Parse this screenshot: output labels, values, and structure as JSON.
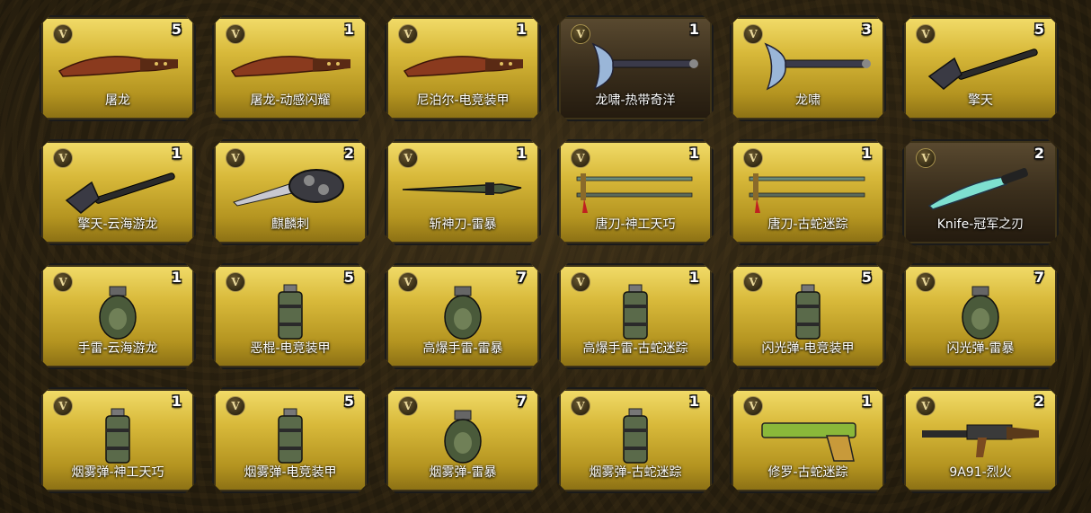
{
  "badge_letter": "V",
  "items": [
    {
      "name": "屠龙",
      "count": "5",
      "icon": "kukri-knife-icon",
      "dark": false
    },
    {
      "name": "屠龙-动感闪耀",
      "count": "1",
      "icon": "kukri-knife-icon",
      "dark": false
    },
    {
      "name": "尼泊尔-电竞装甲",
      "count": "1",
      "icon": "kukri-knife-icon",
      "dark": false
    },
    {
      "name": "龙啸-热带奇洋",
      "count": "1",
      "icon": "axe-icon",
      "dark": true
    },
    {
      "name": "龙啸",
      "count": "3",
      "icon": "axe-icon",
      "dark": false
    },
    {
      "name": "擎天",
      "count": "5",
      "icon": "shovel-icon",
      "dark": false
    },
    {
      "name": "擎天-云海游龙",
      "count": "1",
      "icon": "shovel-icon",
      "dark": false
    },
    {
      "name": "麒麟刺",
      "count": "2",
      "icon": "knuckle-blade-icon",
      "dark": false
    },
    {
      "name": "斩神刀-雷暴",
      "count": "1",
      "icon": "long-blade-icon",
      "dark": false
    },
    {
      "name": "唐刀-神工天巧",
      "count": "1",
      "icon": "katana-icon",
      "dark": false
    },
    {
      "name": "唐刀-古蛇迷踪",
      "count": "1",
      "icon": "katana-icon",
      "dark": false
    },
    {
      "name": "Knife-冠军之刃",
      "count": "2",
      "icon": "combat-knife-icon",
      "dark": true
    },
    {
      "name": "手雷-云海游龙",
      "count": "1",
      "icon": "grenade-icon",
      "dark": false
    },
    {
      "name": "恶棍-电竞装甲",
      "count": "5",
      "icon": "canister-grenade-icon",
      "dark": false
    },
    {
      "name": "高爆手雷-雷暴",
      "count": "7",
      "icon": "grenade-icon",
      "dark": false
    },
    {
      "name": "高爆手雷-古蛇迷踪",
      "count": "1",
      "icon": "canister-grenade-icon",
      "dark": false
    },
    {
      "name": "闪光弹-电竞装甲",
      "count": "5",
      "icon": "canister-grenade-icon",
      "dark": false
    },
    {
      "name": "闪光弹-雷暴",
      "count": "7",
      "icon": "grenade-icon",
      "dark": false
    },
    {
      "name": "烟雾弹-神工天巧",
      "count": "1",
      "icon": "canister-grenade-icon",
      "dark": false
    },
    {
      "name": "烟雾弹-电竞装甲",
      "count": "5",
      "icon": "canister-grenade-icon",
      "dark": false
    },
    {
      "name": "烟雾弹-雷暴",
      "count": "7",
      "icon": "grenade-icon",
      "dark": false
    },
    {
      "name": "烟雾弹-古蛇迷踪",
      "count": "1",
      "icon": "canister-grenade-icon",
      "dark": false
    },
    {
      "name": "修罗-古蛇迷踪",
      "count": "1",
      "icon": "pistol-icon",
      "dark": false
    },
    {
      "name": "9A91-烈火",
      "count": "2",
      "icon": "rifle-icon",
      "dark": false
    }
  ]
}
